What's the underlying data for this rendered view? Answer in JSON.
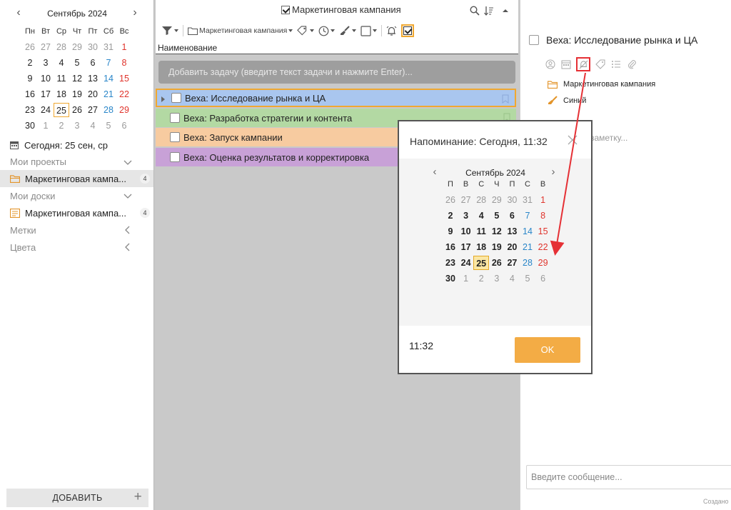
{
  "left_panel": {
    "calendar": {
      "month_title": "Сентябрь 2024",
      "weekdays": [
        "Пн",
        "Вт",
        "Ср",
        "Чт",
        "Пт",
        "Сб",
        "Вс"
      ],
      "weeks": [
        [
          "26",
          "27",
          "28",
          "29",
          "30",
          "31",
          "1"
        ],
        [
          "2",
          "3",
          "4",
          "5",
          "6",
          "7",
          "8"
        ],
        [
          "9",
          "10",
          "11",
          "12",
          "13",
          "14",
          "15"
        ],
        [
          "16",
          "17",
          "18",
          "19",
          "20",
          "21",
          "22"
        ],
        [
          "23",
          "24",
          "25",
          "26",
          "27",
          "28",
          "29"
        ],
        [
          "30",
          "1",
          "2",
          "3",
          "4",
          "5",
          "6"
        ]
      ],
      "today": "25"
    },
    "today_label": "Сегодня: 25 сен, ср",
    "sections": {
      "projects_label": "Мои проекты",
      "boards_label": "Мои доски",
      "tags_label": "Метки",
      "colors_label": "Цвета"
    },
    "project_item": {
      "label": "Маркетинговая кампа...",
      "count": "4"
    },
    "board_item": {
      "label": "Маркетинговая кампа...",
      "count": "4"
    },
    "add_button_label": "ДОБАВИТЬ",
    "add_button_plus": "+"
  },
  "middle_panel": {
    "title": "Маркетинговая кампания",
    "toolbar_project_label": "Маркетинговая кампания",
    "column_header": "Наименование",
    "add_task_placeholder": "Добавить задачу (введите текст задачи и нажмите Enter)...",
    "tasks": [
      {
        "title": "Веха: Исследование рынка и ЦА",
        "color": "#a9c6ef"
      },
      {
        "title": "Веха: Разработка стратегии и контента",
        "color": "#b3d9a3"
      },
      {
        "title": "Веха: Запуск кампании",
        "color": "#f7cba0"
      },
      {
        "title": "Веха: Оценка результатов и корректировка",
        "color": "#c8a1d7"
      }
    ]
  },
  "right_panel": {
    "task_title": "Веха: Исследование рынка и ЦА",
    "project_name": "Маркетинговая кампания",
    "color_name": "Синий",
    "note_hint": "заметку...",
    "message_placeholder": "Введите сообщение...",
    "created_label": "Создано"
  },
  "reminder_dialog": {
    "title": "Напоминание: Сегодня, 11:32",
    "calendar": {
      "month_title": "Сентябрь 2024",
      "weekdays": [
        "П",
        "В",
        "С",
        "Ч",
        "П",
        "С",
        "В"
      ],
      "weeks": [
        [
          "26",
          "27",
          "28",
          "29",
          "30",
          "31",
          "1"
        ],
        [
          "2",
          "3",
          "4",
          "5",
          "6",
          "7",
          "8"
        ],
        [
          "9",
          "10",
          "11",
          "12",
          "13",
          "14",
          "15"
        ],
        [
          "16",
          "17",
          "18",
          "19",
          "20",
          "21",
          "22"
        ],
        [
          "23",
          "24",
          "25",
          "26",
          "27",
          "28",
          "29"
        ],
        [
          "30",
          "1",
          "2",
          "3",
          "4",
          "5",
          "6"
        ]
      ],
      "selected": "25"
    },
    "time_value": "11:32",
    "ok_label": "OK"
  },
  "colors": {
    "accent": "#f0a830",
    "ok_button": "#f3ac45",
    "annotation_red": "#e53035",
    "weekend_blue": "#2a86c9",
    "weekend_red": "#e0342c"
  }
}
